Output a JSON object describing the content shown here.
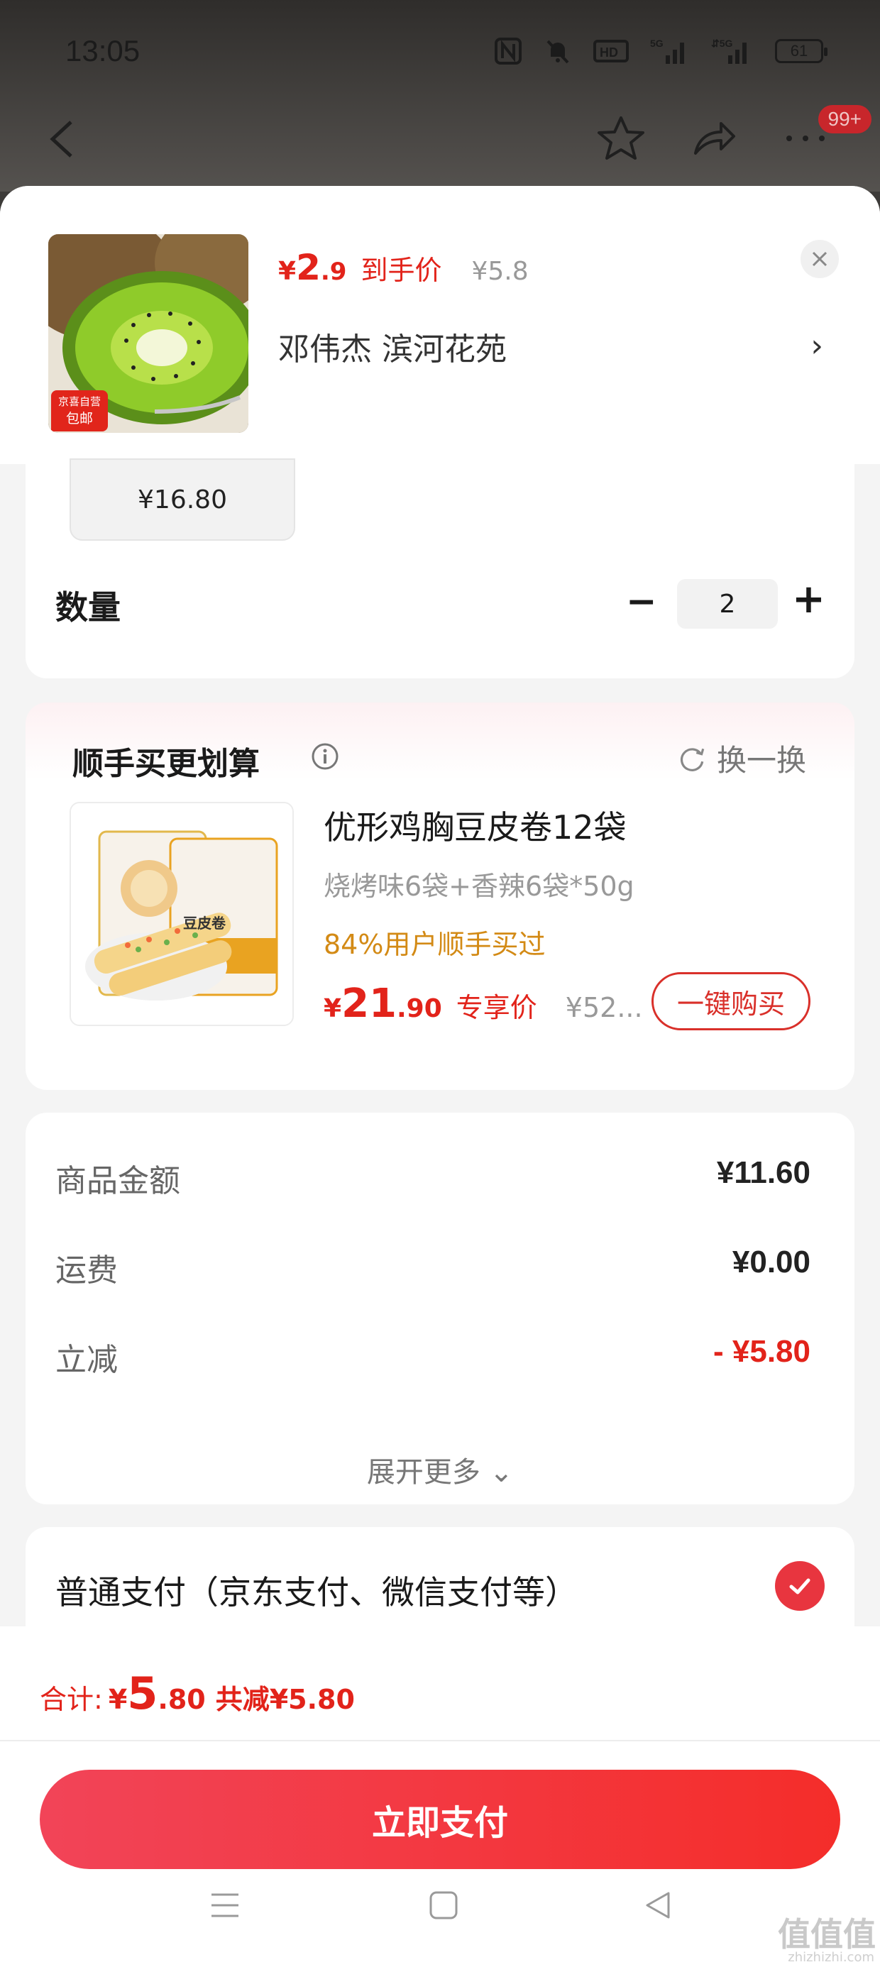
{
  "status_bar": {
    "time": "13:05",
    "battery": "61",
    "icons": [
      "nfc-icon",
      "mute-icon",
      "hd-icon",
      "5g-signal-icon",
      "5g-signal-icon",
      "battery-icon"
    ]
  },
  "app_nav": {
    "badge": "99+",
    "icons": [
      "back-icon",
      "star-icon",
      "share-icon",
      "more-icon"
    ]
  },
  "product": {
    "tag_line1": "京喜自营",
    "tag_line2": "包邮",
    "price_currency": "¥",
    "price_int": "2",
    "price_dec": ".9",
    "price_label": "到手价",
    "original_price": "¥5.8",
    "address": "邓伟杰  滨河花苑",
    "chevron": "›",
    "close": "✕"
  },
  "spec": {
    "selected_price": "¥16.80"
  },
  "quantity": {
    "label": "数量",
    "minus": "−",
    "value": "2",
    "plus": "+"
  },
  "recommendation": {
    "title": "顺手买更划算",
    "swap_label": "换一换",
    "name": "优形鸡胸豆皮卷12袋",
    "spec": "烧烤味6袋+香辣6袋*50g",
    "stat": "84%用户顺手买过",
    "price_currency": "¥",
    "price_int": "21",
    "price_dec": ".90",
    "price_label": "专享价",
    "original_price": "¥52...",
    "buy_label": "一键购买",
    "img_text": "豆皮卷"
  },
  "price_detail": {
    "rows": [
      {
        "label": "商品金额",
        "value": "¥11.60"
      },
      {
        "label": "运费",
        "value": "¥0.00"
      },
      {
        "label": "立减",
        "value": "- ¥5.80"
      }
    ],
    "expand_label": "展开更多 ⌄"
  },
  "payment": {
    "label": "普通支付（京东支付、微信支付等）",
    "selected": true
  },
  "summary": {
    "label": "合计:",
    "currency": "¥",
    "int": "5",
    "dec": ".80",
    "saving": "共减¥5.80",
    "pay_button": "立即支付"
  },
  "watermark": {
    "text": "值值值",
    "sub": "zhizhizhi.com"
  },
  "colors": {
    "accent_red": "#e2231a",
    "pay_gradient_start": "#f24458",
    "pay_gradient_end": "#f42d2a",
    "stat_orange": "#d38a15"
  }
}
